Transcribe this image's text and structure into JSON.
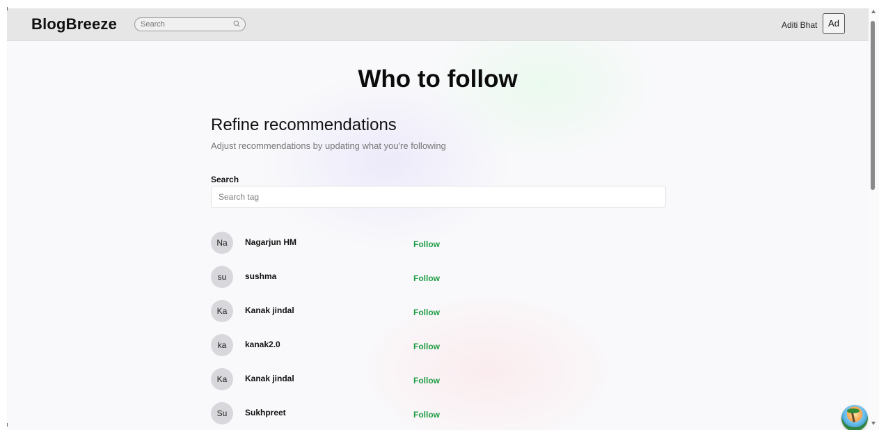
{
  "navbar": {
    "brand": "BlogBreeze",
    "search_placeholder": "Search",
    "username": "Aditi Bhat",
    "avatar_initials": "Ad"
  },
  "page": {
    "title": "Who to follow",
    "refine_title": "Refine recommendations",
    "refine_subtitle": "Adjust recommendations by updating what you're following",
    "search_label": "Search",
    "search_placeholder": "Search tag"
  },
  "users": [
    {
      "initials": "Na",
      "name": "Nagarjun HM",
      "action": "Follow"
    },
    {
      "initials": "su",
      "name": "sushma",
      "action": "Follow"
    },
    {
      "initials": "Ka",
      "name": "Kanak jindal",
      "action": "Follow"
    },
    {
      "initials": "ka",
      "name": "kanak2.0",
      "action": "Follow"
    },
    {
      "initials": "Ka",
      "name": "Kanak jindal",
      "action": "Follow"
    },
    {
      "initials": "Su",
      "name": "Sukhpreet",
      "action": "Follow"
    }
  ],
  "colors": {
    "follow": "#1f9d45",
    "navbar_bg": "#e6e6e6"
  },
  "icons": {
    "nav_search": "search-icon",
    "fab": "palm-beach-icon"
  }
}
